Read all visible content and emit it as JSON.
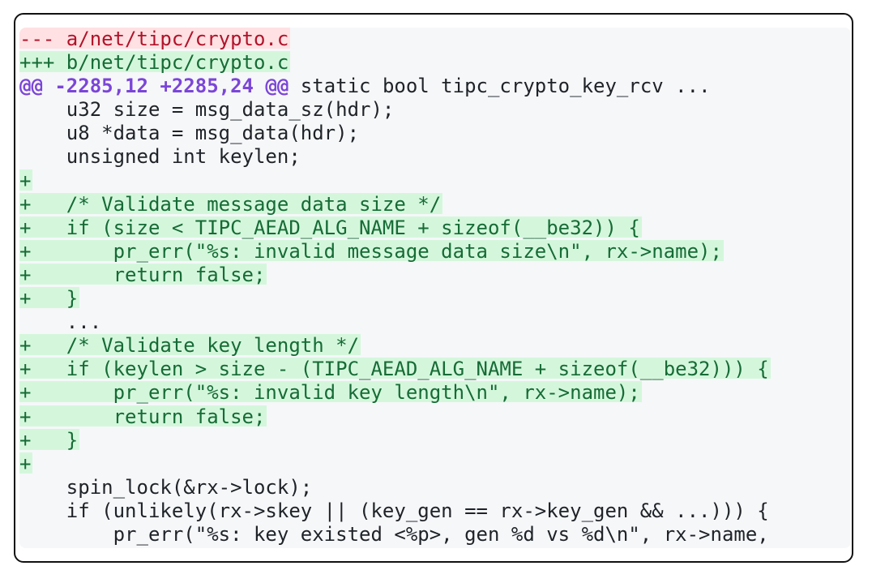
{
  "diff": {
    "lines": [
      {
        "type": "del",
        "text": "--- a/net/tipc/crypto.c"
      },
      {
        "type": "add",
        "text": "+++ b/net/tipc/crypto.c"
      },
      {
        "type": "hunk",
        "marker": "@@ -2285,12 +2285,24 @@",
        "rest": " static bool tipc_crypto_key_rcv ..."
      },
      {
        "type": "ctx",
        "text": "    u32 size = msg_data_sz(hdr);"
      },
      {
        "type": "ctx",
        "text": "    u8 *data = msg_data(hdr);"
      },
      {
        "type": "ctx",
        "text": "    unsigned int keylen;"
      },
      {
        "type": "add",
        "text": "+"
      },
      {
        "type": "add",
        "text": "+   /* Validate message data size */"
      },
      {
        "type": "add",
        "text": "+   if (size < TIPC_AEAD_ALG_NAME + sizeof(__be32)) {"
      },
      {
        "type": "add",
        "text": "+       pr_err(\"%s: invalid message data size\\n\", rx->name);"
      },
      {
        "type": "add",
        "text": "+       return false;"
      },
      {
        "type": "add",
        "text": "+   }"
      },
      {
        "type": "ctx",
        "text": "    ..."
      },
      {
        "type": "add",
        "text": "+   /* Validate key length */"
      },
      {
        "type": "add",
        "text": "+   if (keylen > size - (TIPC_AEAD_ALG_NAME + sizeof(__be32))) {"
      },
      {
        "type": "add",
        "text": "+       pr_err(\"%s: invalid key length\\n\", rx->name);"
      },
      {
        "type": "add",
        "text": "+       return false;"
      },
      {
        "type": "add",
        "text": "+   }"
      },
      {
        "type": "add",
        "text": "+"
      },
      {
        "type": "ctx",
        "text": "    spin_lock(&rx->lock);"
      },
      {
        "type": "ctx",
        "text": "    if (unlikely(rx->skey || (key_gen == rx->key_gen && ...))) {"
      },
      {
        "type": "ctx",
        "text": "        pr_err(\"%s: key existed <%p>, gen %d vs %d\\n\", rx->name,"
      }
    ]
  }
}
